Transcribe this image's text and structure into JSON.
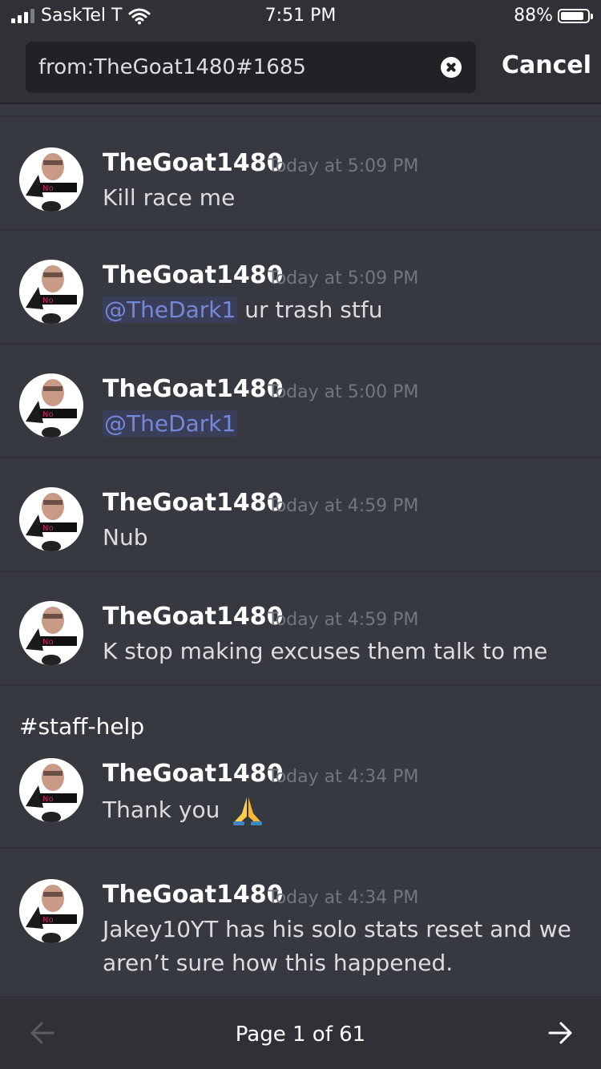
{
  "status_bar": {
    "carrier": "SaskTel T",
    "time": "7:51 PM",
    "battery": "88%"
  },
  "search": {
    "value": "from:TheGoat1480#1685",
    "cancel_label": "Cancel"
  },
  "results": [
    {
      "author": "TheGoat1480",
      "timestamp": "Today at 5:09 PM",
      "text": "Kill race me"
    },
    {
      "author": "TheGoat1480",
      "timestamp": "Today at 5:09 PM",
      "mention": "@TheDark1",
      "text": "ur trash stfu"
    },
    {
      "author": "TheGoat1480",
      "timestamp": "Today at 5:00 PM",
      "mention": "@TheDark1"
    },
    {
      "author": "TheGoat1480",
      "timestamp": "Today at 4:59 PM",
      "text": "Nub"
    },
    {
      "author": "TheGoat1480",
      "timestamp": "Today at 4:59 PM",
      "text": "K stop making excuses them talk to me"
    },
    {
      "channel": "#staff-help",
      "author": "TheGoat1480",
      "timestamp": "Today at 4:34 PM",
      "text": "Thank you",
      "emoji": "folded-hands"
    },
    {
      "author": "TheGoat1480",
      "timestamp": "Today at 4:34 PM",
      "text_line1": "Jakey10YT has his solo stats reset and we",
      "text_line2": "aren’t sure how this happened."
    }
  ],
  "pagination": {
    "label": "Page 1 of 61"
  },
  "icons": {
    "prev": "arrow-left-icon",
    "next": "arrow-right-icon",
    "clear": "clear-icon"
  },
  "colors": {
    "background": "#36393f",
    "header": "#2f3136",
    "mention": "#7289da",
    "timestamp": "#72767d"
  }
}
